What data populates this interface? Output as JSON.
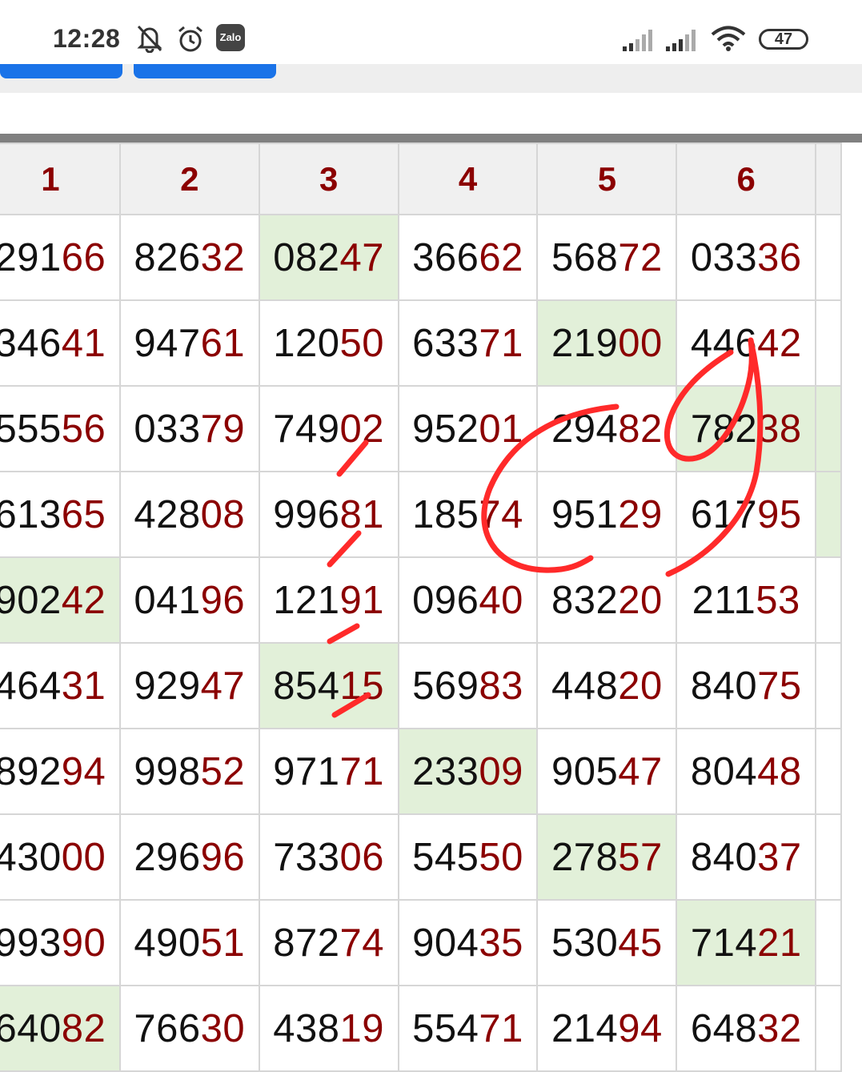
{
  "status_bar": {
    "time": "12:28",
    "icons": [
      "bell-off-icon",
      "alarm-icon",
      "zalo-icon",
      "signal-icon",
      "signal-icon",
      "wifi-icon"
    ],
    "zalo_label": "Zalo",
    "battery": "47"
  },
  "table": {
    "columns": [
      "1",
      "2",
      "3",
      "4",
      "5",
      "6"
    ],
    "rows": [
      [
        [
          "291",
          "66"
        ],
        [
          "826",
          "32"
        ],
        [
          "082",
          "47"
        ],
        [
          "366",
          "62"
        ],
        [
          "568",
          "72"
        ],
        [
          "033",
          "36"
        ]
      ],
      [
        [
          "346",
          "41"
        ],
        [
          "947",
          "61"
        ],
        [
          "120",
          "50"
        ],
        [
          "633",
          "71"
        ],
        [
          "219",
          "00"
        ],
        [
          "446",
          "42"
        ]
      ],
      [
        [
          "555",
          "56"
        ],
        [
          "033",
          "79"
        ],
        [
          "749",
          "02"
        ],
        [
          "952",
          "01"
        ],
        [
          "294",
          "82"
        ],
        [
          "782",
          "38"
        ]
      ],
      [
        [
          "613",
          "65"
        ],
        [
          "428",
          "08"
        ],
        [
          "996",
          "81"
        ],
        [
          "185",
          "74"
        ],
        [
          "951",
          "29"
        ],
        [
          "617",
          "95"
        ]
      ],
      [
        [
          "902",
          "42"
        ],
        [
          "041",
          "96"
        ],
        [
          "121",
          "91"
        ],
        [
          "096",
          "40"
        ],
        [
          "832",
          "20"
        ],
        [
          "211",
          "53"
        ]
      ],
      [
        [
          "464",
          "31"
        ],
        [
          "929",
          "47"
        ],
        [
          "854",
          "15"
        ],
        [
          "569",
          "83"
        ],
        [
          "448",
          "20"
        ],
        [
          "840",
          "75"
        ]
      ],
      [
        [
          "892",
          "94"
        ],
        [
          "998",
          "52"
        ],
        [
          "971",
          "71"
        ],
        [
          "233",
          "09"
        ],
        [
          "905",
          "47"
        ],
        [
          "804",
          "48"
        ]
      ],
      [
        [
          "430",
          "00"
        ],
        [
          "296",
          "96"
        ],
        [
          "733",
          "06"
        ],
        [
          "545",
          "50"
        ],
        [
          "278",
          "57"
        ],
        [
          "840",
          "37"
        ]
      ],
      [
        [
          "993",
          "90"
        ],
        [
          "490",
          "51"
        ],
        [
          "872",
          "74"
        ],
        [
          "904",
          "35"
        ],
        [
          "530",
          "45"
        ],
        [
          "714",
          "21"
        ]
      ],
      [
        [
          "640",
          "82"
        ],
        [
          "766",
          "30"
        ],
        [
          "438",
          "19"
        ],
        [
          "554",
          "71"
        ],
        [
          "214",
          "94"
        ],
        [
          "648",
          "32"
        ]
      ]
    ],
    "highlighted": [
      [
        0,
        2
      ],
      [
        1,
        4
      ],
      [
        2,
        5
      ],
      [
        4,
        0
      ],
      [
        5,
        2
      ],
      [
        6,
        3
      ],
      [
        7,
        4
      ],
      [
        8,
        5
      ],
      [
        9,
        0
      ]
    ]
  },
  "colors": {
    "accent": "#1a73e8",
    "tail": "#8b0000",
    "highlight": "#e2f0d9",
    "ink": "#ff2a2a"
  }
}
